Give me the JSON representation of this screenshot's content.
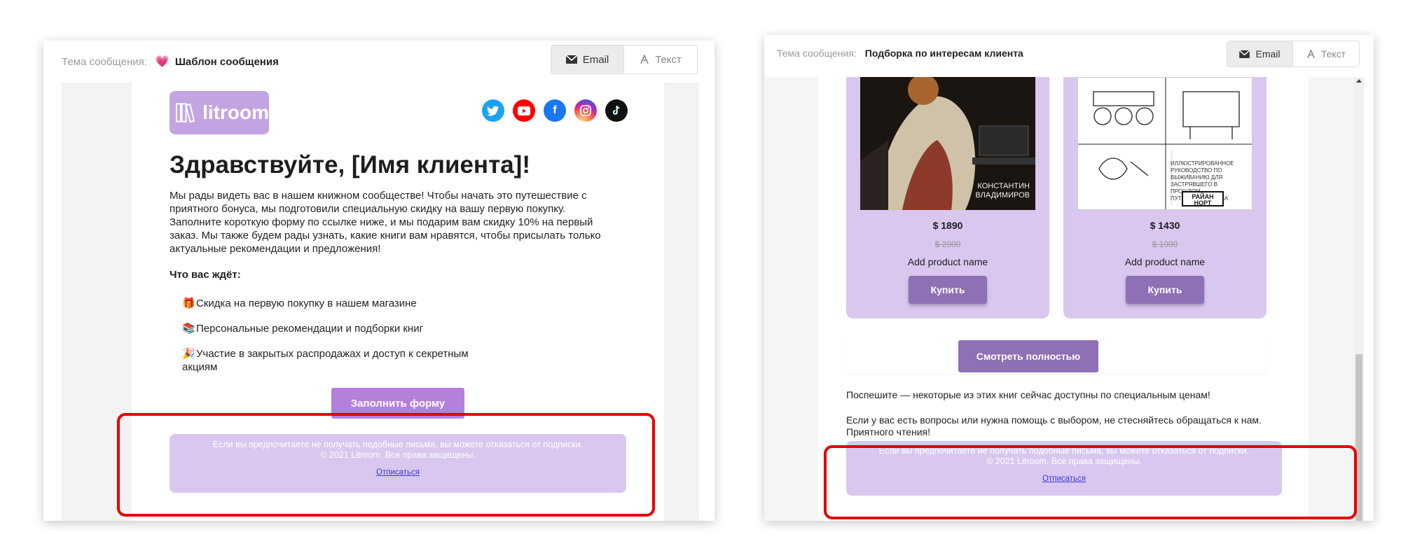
{
  "left_panel": {
    "subject_label": "Тема сообщения:",
    "subject_value": "Шаблон сообщения",
    "tabs": {
      "email": "Email",
      "text": "Текст"
    },
    "logo_text": "litroom",
    "social_icons": [
      "twitter-icon",
      "youtube-icon",
      "facebook-icon",
      "instagram-icon",
      "tiktok-icon"
    ],
    "greeting": "Здравствуйте, [Имя клиента]!",
    "intro": "Мы рады видеть вас в нашем книжном сообществе! Чтобы начать это путешествие с приятного бонуса, мы подготовили специальную скидку на вашу первую покупку. Заполните короткую форму по ссылке ниже, и мы подарим вам скидку 10% на первый заказ. Мы также будем рады узнать, какие книги вам нравятся, чтобы присылать только актуальные рекомендации и предложения!",
    "benefits_title": "Что вас ждёт:",
    "benefits": [
      {
        "emoji": "🎁",
        "text": "Скидка на первую покупку в нашем магазине"
      },
      {
        "emoji": "📚",
        "text": "Персональные рекомендации и подборки книг"
      },
      {
        "emoji": "🎉",
        "text": "Участие в закрытых распродажах и доступ к секретным акциям"
      }
    ],
    "cta_button": "Заполнить форму",
    "footer": {
      "line1": "Если вы предпочитаете не получать подобные письма, вы можете отказаться от подписки.",
      "line2": "© 2021 Litroom. Все права защищены.",
      "unsubscribe": "Отписаться"
    }
  },
  "right_panel": {
    "subject_label": "Тема сообщения:",
    "subject_value": "Подборка по интересам клиента",
    "tabs": {
      "email": "Email",
      "text": "Текст"
    },
    "products": [
      {
        "cover_author": "КОНСТАНТИН ВЛАДИМИРОВ",
        "price": "$ 1890",
        "old_price": "$ 2990",
        "name": "Add product name",
        "buy": "Купить"
      },
      {
        "cover_author": "РАЙАН НОРТ",
        "price": "$ 1430",
        "old_price": "$ 1990",
        "name": "Add product name",
        "buy": "Купить"
      }
    ],
    "view_all_button": "Смотреть полностью",
    "text1": "Поспешите — некоторые из этих книг сейчас доступны по специальным ценам!",
    "text2": "Если у вас есть вопросы или нужна помощь с выбором, не стесняйтесь обращаться к нам. Приятного чтения!",
    "footer": {
      "line1": "Если вы предпочитаете не получать подобные письма, вы можете отказаться от подписки.",
      "line2": "© 2021 Litroom. Все права защищены.",
      "unsubscribe": "Отписаться"
    }
  },
  "colors": {
    "accent_purple": "#b77fdc",
    "card_purple": "#d9c7f0",
    "button_purple": "#8e70b4",
    "highlight_red": "#e60000"
  }
}
